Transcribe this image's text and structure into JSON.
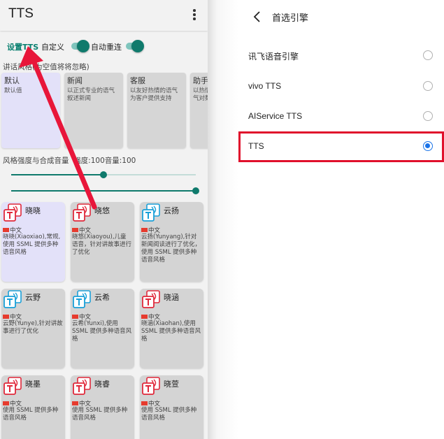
{
  "left": {
    "app_title": "TTS",
    "settings": {
      "tts_link": "设置TTS",
      "custom_label": "自定义",
      "auto_reconnect_label": "自动重连"
    },
    "style_label": "讲话风格(为空值将将忽略)",
    "style_cards": [
      {
        "name": "默认",
        "desc": "默认值"
      },
      {
        "name": "新闻",
        "desc": "以正式专业的语气叙述新闻"
      },
      {
        "name": "客服",
        "desc": "以友好热情的语气为客户提供支持"
      },
      {
        "name": "助手",
        "desc": "以热情而轻松的语气对数字助理讲话"
      }
    ],
    "strength_label": "风格强度与合成音量",
    "strength_value": "强度:100音量:100",
    "slider_strength_fraction": 0.5,
    "slider_volume_fraction": 1.0,
    "voices": [
      {
        "name": "晓晓",
        "lang": "中文",
        "desc": "晓晓(Xiaoxiao),常规,使用 SSML 提供多种语音风格"
      },
      {
        "name": "晓悠",
        "lang": "中文",
        "desc": "晓悠(Xiaoyou),儿童语音，针对讲故事进行了优化"
      },
      {
        "name": "云扬",
        "lang": "中文",
        "desc": "云扬(Yunyang),针对新闻阅读进行了优化，使用 SSML 提供多种语音风格"
      },
      {
        "name": "云野",
        "lang": "中文",
        "desc": "云野(Yunye),针对讲故事进行了优化"
      },
      {
        "name": "云希",
        "lang": "中文",
        "desc": "云希(Yunxi),使用 SSML 提供多种语音风格"
      },
      {
        "name": "晓涵",
        "lang": "中文",
        "desc": "晓涵(Xiaohan),使用 SSML 提供多种语音风格"
      },
      {
        "name": "晓墨",
        "lang": "中文",
        "desc": "使用 SSML 提供多种语音风格"
      },
      {
        "name": "晓睿",
        "lang": "中文",
        "desc": "使用 SSML 提供多种语音风格"
      },
      {
        "name": "晓萱",
        "lang": "中文",
        "desc": "使用 SSML 提供多种语音风格"
      }
    ]
  },
  "right": {
    "title": "首选引擎",
    "engines": [
      {
        "name": "讯飞语音引擎",
        "selected": false
      },
      {
        "name": "vivo TTS",
        "selected": false
      },
      {
        "name": "AIService TTS",
        "selected": false
      },
      {
        "name": "TTS",
        "selected": true
      }
    ]
  },
  "colors": {
    "accent": "#0f7a6c",
    "radio_selected": "#1a73e8",
    "annotation_red": "#e0102c",
    "selected_card": "#e3e1f9"
  }
}
